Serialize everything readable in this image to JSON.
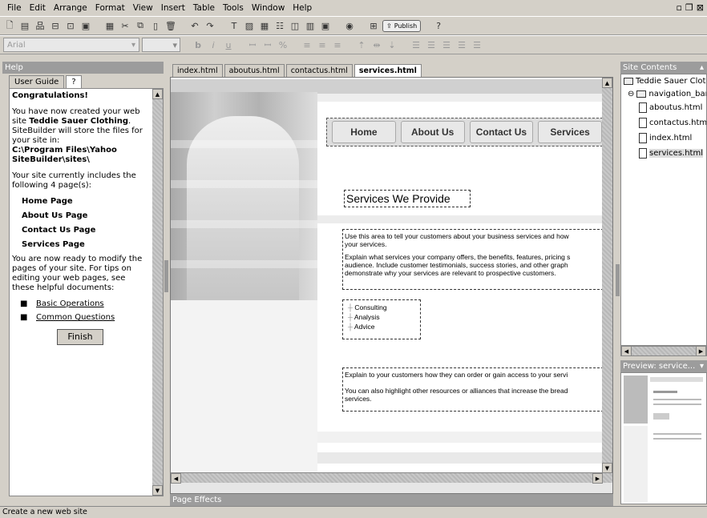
{
  "menu": [
    "File",
    "Edit",
    "Arrange",
    "Format",
    "View",
    "Insert",
    "Table",
    "Tools",
    "Window",
    "Help"
  ],
  "toolbar": {
    "publish_label": "Publish"
  },
  "format": {
    "font": "Arial"
  },
  "help": {
    "title": "Help",
    "tabs": [
      "User Guide",
      "?"
    ],
    "congrats": "Congratulations!",
    "p1_a": "You have now created your web site ",
    "p1_b": "Teddie Sauer Clothing",
    "p1_c": ". SiteBuilder will store the files for your site in:",
    "p1_path": "C:\\Program Files\\Yahoo SiteBuilder\\sites\\",
    "p2": "Your site currently includes the following 4 page(s):",
    "pages": [
      "Home Page",
      "About Us Page",
      "Contact Us Page",
      "Services Page"
    ],
    "p3": "You are now ready to modify the pages of your site. For tips on editing your web pages, see these helpful documents:",
    "docs": [
      "Basic Operations",
      "Common Questions"
    ],
    "finish": "Finish"
  },
  "tabs": [
    "index.html",
    "aboutus.html",
    "contactus.html",
    "services.html"
  ],
  "editor": {
    "nav": [
      "Home",
      "About Us",
      "Contact Us",
      "Services"
    ],
    "title": "Services We Provide",
    "para1": "Use this area to tell your customers about your business services and how",
    "para1b": "your services.",
    "para2a": "Explain what services your company offers, the benefits, features, pricing s",
    "para2b": "audience. Include customer testimonials, success stories, and other graph",
    "para2c": "demonstrate why your services are relevant to prospective customers.",
    "list": [
      "Consulting",
      "Analysis",
      "Advice"
    ],
    "para3": "Explain to your customers how they can order or gain access to your servi",
    "para4a": "You can also highlight other resources or alliances that increase the bread",
    "para4b": "services."
  },
  "page_effects": "Page Effects",
  "site": {
    "title": "Site Contents",
    "root": "Teddie Sauer Clot",
    "folder": "navigation_bar",
    "files": [
      "aboutus.html",
      "contactus.htm",
      "index.html",
      "services.html"
    ]
  },
  "preview": {
    "title": "Preview: service..."
  },
  "status": "Create a new web site"
}
